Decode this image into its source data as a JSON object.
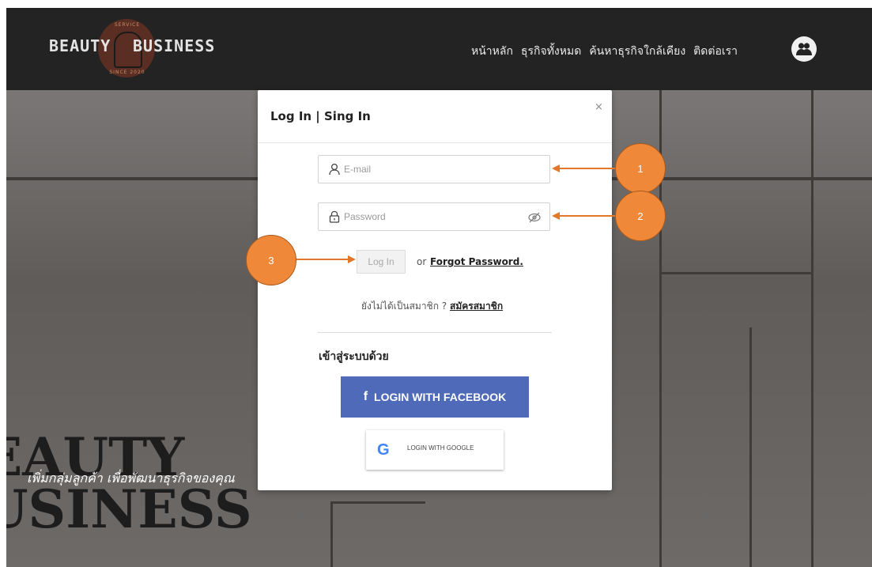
{
  "logo": {
    "top": "SERVICE",
    "word1": "BEAUTY",
    "word2": "BUSINESS",
    "bottom": "SINCE 2020"
  },
  "nav": {
    "links": [
      "หน้าหลัก",
      "ธุรกิจทั้งหมด",
      "ค้นหาธุรกิจใกล้เคียง",
      "ติดต่อเรา"
    ]
  },
  "hero": {
    "title_line1": "EAUTY",
    "title_line2": "USINESS",
    "subtitle": "เพิ่มกลุ่มลูกค้า เพื่อพัฒนาธุรกิจของคุณ"
  },
  "modal": {
    "title": "Log In | Sing In",
    "close": "×",
    "email_placeholder": "E-mail",
    "password_placeholder": "Password",
    "login_button": "Log In",
    "or_text": "or",
    "forgot_password": "Forgot Password.",
    "not_member": "ยังไม่ได้เป็นสมาชิก ?",
    "signup": "สมัครสมาชิก",
    "login_with": "เข้าสู่ระบบด้วย",
    "facebook_icon": "f",
    "facebook_button": "LOGIN WITH FACEBOOK",
    "google_icon": "G",
    "google_button": "LOGIN WITH GOOGLE"
  },
  "callouts": [
    {
      "number": "1",
      "points_to": "email field"
    },
    {
      "number": "2",
      "points_to": "password field"
    },
    {
      "number": "3",
      "points_to": "login button"
    }
  ],
  "colors": {
    "accent": "#f0883a",
    "facebook": "#4e6ab8",
    "navbar": "#232323"
  }
}
